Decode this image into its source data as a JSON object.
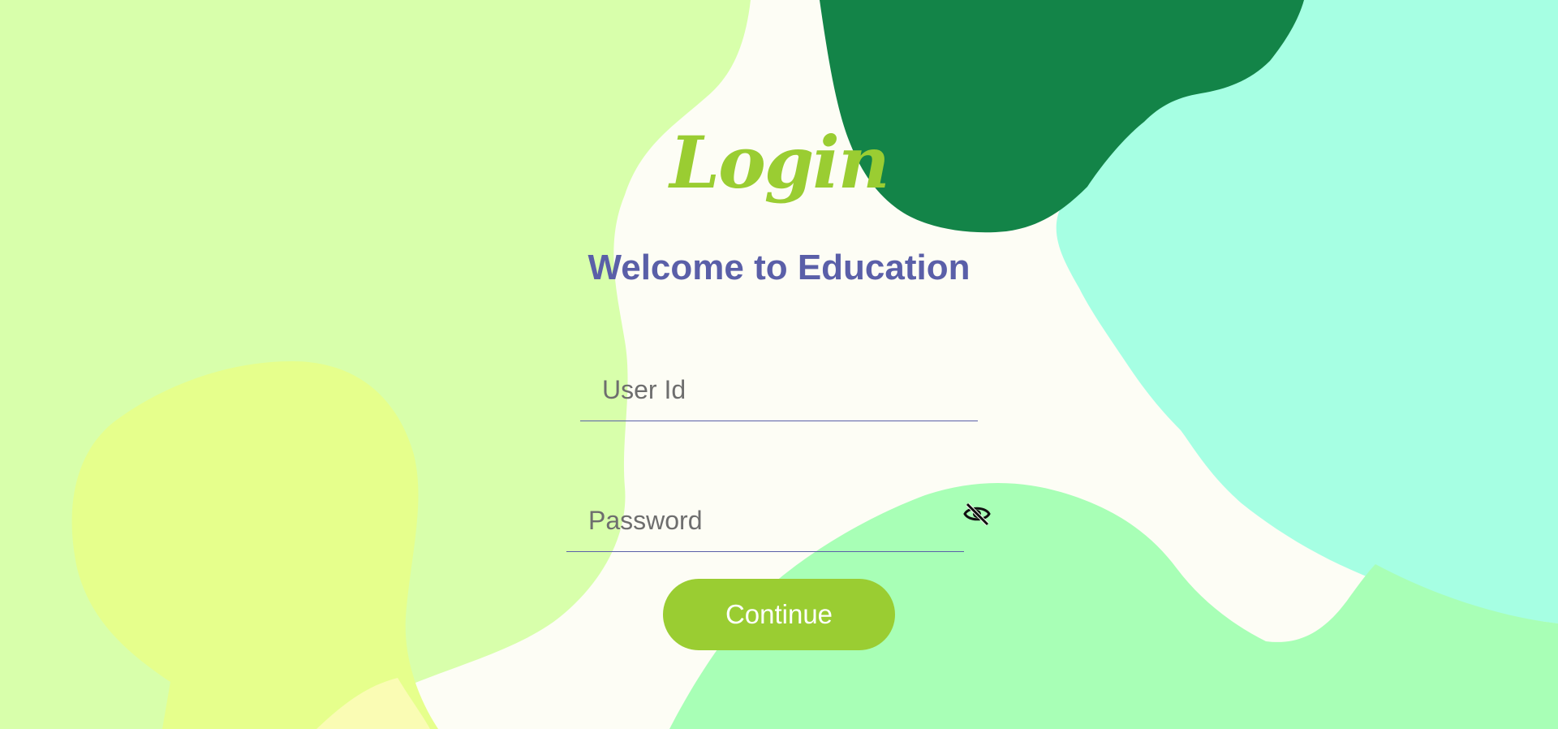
{
  "page": {
    "title": "Login",
    "subtitle": "Welcome to Education"
  },
  "form": {
    "user_id": {
      "placeholder": "User Id",
      "value": ""
    },
    "password": {
      "placeholder": "Password",
      "value": ""
    },
    "password_toggle_icon": "eye-slash-icon",
    "submit_label": "Continue"
  },
  "colors": {
    "background": "#fdfdf5",
    "blob_light_green": "#d8ffab",
    "blob_yellow_green": "#e6ff8c",
    "blob_dark_green": "#138448",
    "blob_aqua": "#a6ffe3",
    "blob_mint": "#a8ffb6",
    "accent": "#9acd32",
    "heading": "#5a5fa8"
  }
}
